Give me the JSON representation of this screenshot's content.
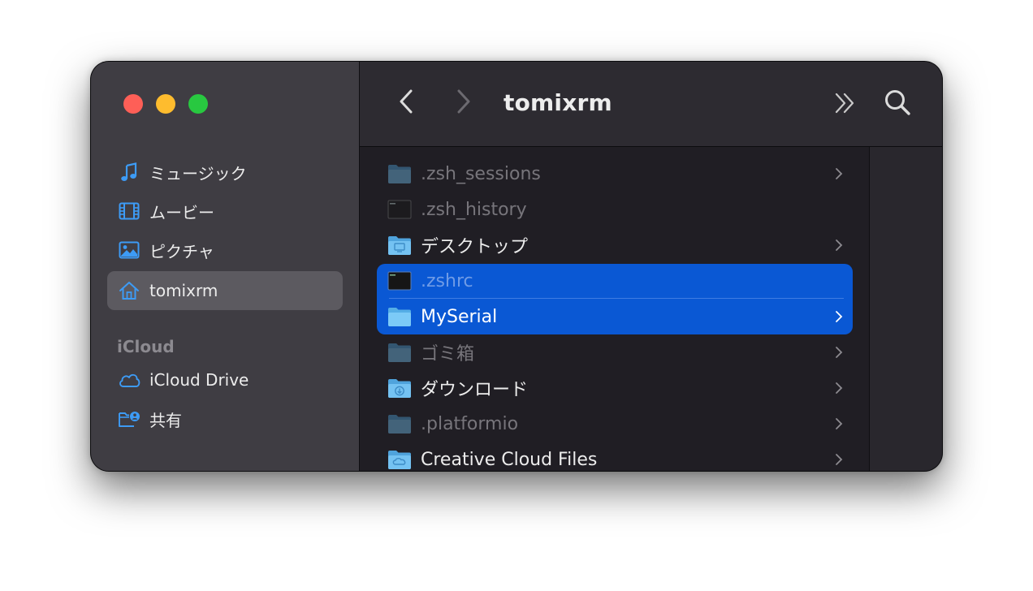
{
  "window": {
    "title": "tomixrm"
  },
  "toolbar": {
    "back_icon": "chevron-left-icon",
    "forward_icon": "chevron-right-icon",
    "more_icon": "double-chevron-right-icon",
    "search_icon": "magnifier-icon"
  },
  "sidebar": {
    "favorites": [
      {
        "label": "ミュージック",
        "icon": "music-note-icon"
      },
      {
        "label": "ムービー",
        "icon": "film-icon"
      },
      {
        "label": "ピクチャ",
        "icon": "photo-icon"
      },
      {
        "label": "tomixrm",
        "icon": "house-icon",
        "selected": true
      }
    ],
    "icloud_header": "iCloud",
    "icloud": [
      {
        "label": "iCloud Drive",
        "icon": "cloud-icon"
      },
      {
        "label": "共有",
        "icon": "shared-folder-icon"
      }
    ]
  },
  "files": [
    {
      "name": ".zsh_sessions",
      "kind": "folder",
      "hidden": true,
      "chevron": true
    },
    {
      "name": ".zsh_history",
      "kind": "terminal-file",
      "hidden": true,
      "chevron": false
    },
    {
      "name": "デスクトップ",
      "kind": "desktop-folder",
      "hidden": false,
      "chevron": true
    },
    {
      "name": ".zshrc",
      "kind": "terminal-file",
      "hidden": true,
      "selected": true,
      "chevron": false
    },
    {
      "name": "MySerial",
      "kind": "folder",
      "hidden": false,
      "selected": true,
      "chevron": true
    },
    {
      "name": "ゴミ箱",
      "kind": "folder",
      "hidden": true,
      "chevron": true
    },
    {
      "name": "ダウンロード",
      "kind": "downloads-folder",
      "hidden": false,
      "chevron": true
    },
    {
      "name": ".platformio",
      "kind": "folder",
      "hidden": true,
      "chevron": true
    },
    {
      "name": "Creative Cloud Files",
      "kind": "creative-cloud-folder",
      "hidden": false,
      "chevron": true
    }
  ],
  "colors": {
    "accent": "#0a58d4",
    "sidebar_icon": "#3d9bf5",
    "close": "#fe5f57",
    "minimize": "#febc2e",
    "zoom": "#28c840"
  }
}
